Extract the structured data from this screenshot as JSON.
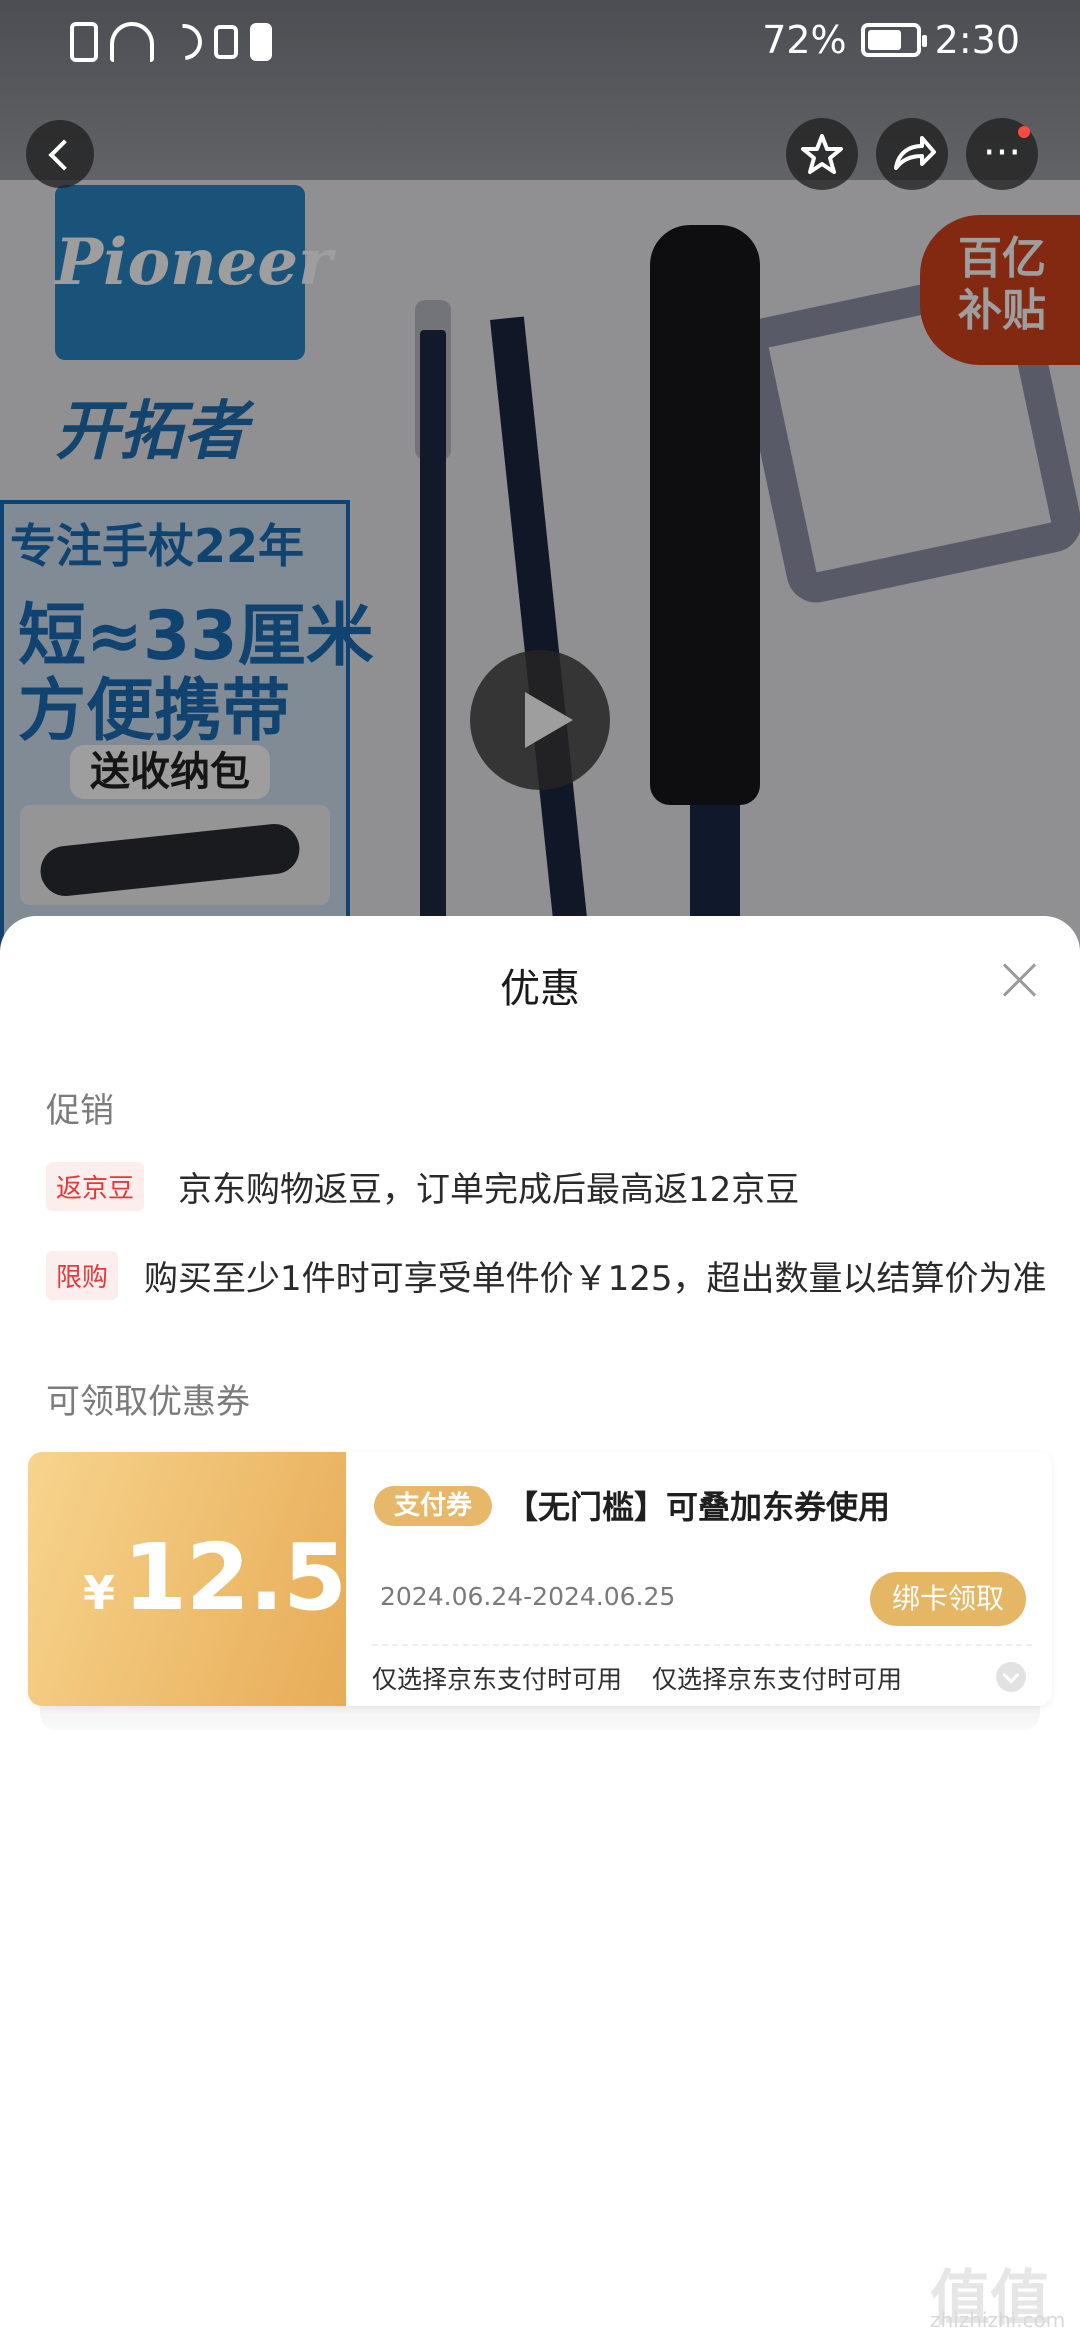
{
  "status_bar": {
    "battery_percent": "72%",
    "battery_level": 0.72,
    "time": "2:30",
    "icons": [
      "alert-icon",
      "wifi-icon",
      "moon-icon",
      "vibrate-icon",
      "battery-saver-icon"
    ]
  },
  "nav": {
    "back_icon": "chevron-left-icon",
    "favorite_icon": "star-icon",
    "share_icon": "share-icon",
    "more_icon": "more-dots-icon",
    "more_glyph": "···"
  },
  "hero": {
    "brand_logo_text": "Pioneer",
    "brand_name": "开拓者",
    "badge_line1": "百亿",
    "badge_line2": "补贴",
    "promo_line1": "专注手杖22年",
    "promo_line2": "短≈33厘米",
    "promo_line3": "方便携带",
    "gift_label": "送收纳包"
  },
  "sheet": {
    "title": "优惠",
    "close_icon": "close-icon",
    "promotions_label": "促销",
    "promotions": [
      {
        "tag": "返京豆",
        "text": "京东购物返豆，订单完成后最高返12京豆"
      },
      {
        "tag": "限购",
        "text": "购买至少1件时可享受单件价￥125，超出数量以结算价为准"
      }
    ],
    "coupons_label": "可领取优惠券",
    "coupon": {
      "currency": "¥",
      "amount": "12.5",
      "badge": "支付券",
      "title": "【无门槛】可叠加东券使用",
      "date_range": "2024.06.24-2024.06.25",
      "button": "绑卡领取",
      "note1": "仅选择京东支付时可用",
      "note2": "仅选择京东支付时可用"
    }
  },
  "watermark": {
    "logo": "值值值",
    "url": "zhizhizhi.com"
  },
  "colors": {
    "accent_gold": "#e5b765",
    "tag_red": "#e23a3a",
    "tag_bg": "#fdeeee",
    "subsidy_red": "#d5431c"
  }
}
